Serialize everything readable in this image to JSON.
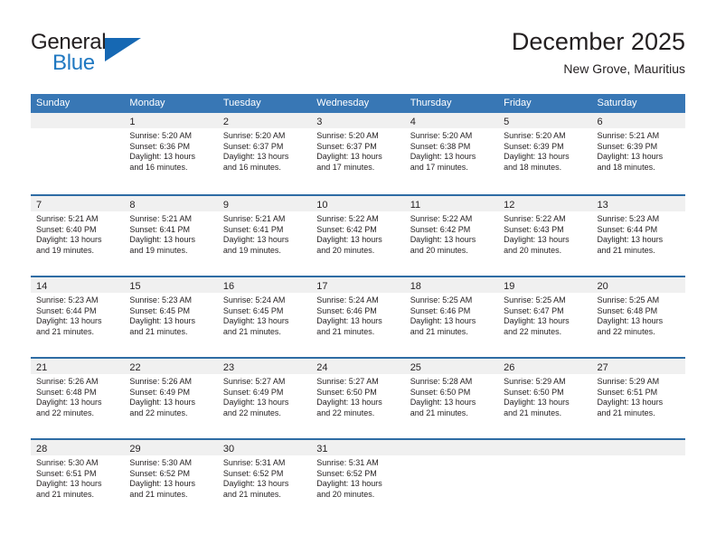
{
  "brand": {
    "name_top": "General",
    "name_bottom": "Blue",
    "accent_color": "#1668b3"
  },
  "header": {
    "title": "December 2025",
    "subtitle": "New Grove, Mauritius"
  },
  "theme": {
    "header_blue": "#3877b5",
    "row_divider_blue": "#2e6ca4",
    "day_band_gray": "#f0f0f0"
  },
  "weekdays": [
    "Sunday",
    "Monday",
    "Tuesday",
    "Wednesday",
    "Thursday",
    "Friday",
    "Saturday"
  ],
  "weeks": [
    [
      {
        "day": "",
        "sunrise": "",
        "sunset": "",
        "daylight_1": "",
        "daylight_2": ""
      },
      {
        "day": "1",
        "sunrise": "Sunrise: 5:20 AM",
        "sunset": "Sunset: 6:36 PM",
        "daylight_1": "Daylight: 13 hours",
        "daylight_2": "and 16 minutes."
      },
      {
        "day": "2",
        "sunrise": "Sunrise: 5:20 AM",
        "sunset": "Sunset: 6:37 PM",
        "daylight_1": "Daylight: 13 hours",
        "daylight_2": "and 16 minutes."
      },
      {
        "day": "3",
        "sunrise": "Sunrise: 5:20 AM",
        "sunset": "Sunset: 6:37 PM",
        "daylight_1": "Daylight: 13 hours",
        "daylight_2": "and 17 minutes."
      },
      {
        "day": "4",
        "sunrise": "Sunrise: 5:20 AM",
        "sunset": "Sunset: 6:38 PM",
        "daylight_1": "Daylight: 13 hours",
        "daylight_2": "and 17 minutes."
      },
      {
        "day": "5",
        "sunrise": "Sunrise: 5:20 AM",
        "sunset": "Sunset: 6:39 PM",
        "daylight_1": "Daylight: 13 hours",
        "daylight_2": "and 18 minutes."
      },
      {
        "day": "6",
        "sunrise": "Sunrise: 5:21 AM",
        "sunset": "Sunset: 6:39 PM",
        "daylight_1": "Daylight: 13 hours",
        "daylight_2": "and 18 minutes."
      }
    ],
    [
      {
        "day": "7",
        "sunrise": "Sunrise: 5:21 AM",
        "sunset": "Sunset: 6:40 PM",
        "daylight_1": "Daylight: 13 hours",
        "daylight_2": "and 19 minutes."
      },
      {
        "day": "8",
        "sunrise": "Sunrise: 5:21 AM",
        "sunset": "Sunset: 6:41 PM",
        "daylight_1": "Daylight: 13 hours",
        "daylight_2": "and 19 minutes."
      },
      {
        "day": "9",
        "sunrise": "Sunrise: 5:21 AM",
        "sunset": "Sunset: 6:41 PM",
        "daylight_1": "Daylight: 13 hours",
        "daylight_2": "and 19 minutes."
      },
      {
        "day": "10",
        "sunrise": "Sunrise: 5:22 AM",
        "sunset": "Sunset: 6:42 PM",
        "daylight_1": "Daylight: 13 hours",
        "daylight_2": "and 20 minutes."
      },
      {
        "day": "11",
        "sunrise": "Sunrise: 5:22 AM",
        "sunset": "Sunset: 6:42 PM",
        "daylight_1": "Daylight: 13 hours",
        "daylight_2": "and 20 minutes."
      },
      {
        "day": "12",
        "sunrise": "Sunrise: 5:22 AM",
        "sunset": "Sunset: 6:43 PM",
        "daylight_1": "Daylight: 13 hours",
        "daylight_2": "and 20 minutes."
      },
      {
        "day": "13",
        "sunrise": "Sunrise: 5:23 AM",
        "sunset": "Sunset: 6:44 PM",
        "daylight_1": "Daylight: 13 hours",
        "daylight_2": "and 21 minutes."
      }
    ],
    [
      {
        "day": "14",
        "sunrise": "Sunrise: 5:23 AM",
        "sunset": "Sunset: 6:44 PM",
        "daylight_1": "Daylight: 13 hours",
        "daylight_2": "and 21 minutes."
      },
      {
        "day": "15",
        "sunrise": "Sunrise: 5:23 AM",
        "sunset": "Sunset: 6:45 PM",
        "daylight_1": "Daylight: 13 hours",
        "daylight_2": "and 21 minutes."
      },
      {
        "day": "16",
        "sunrise": "Sunrise: 5:24 AM",
        "sunset": "Sunset: 6:45 PM",
        "daylight_1": "Daylight: 13 hours",
        "daylight_2": "and 21 minutes."
      },
      {
        "day": "17",
        "sunrise": "Sunrise: 5:24 AM",
        "sunset": "Sunset: 6:46 PM",
        "daylight_1": "Daylight: 13 hours",
        "daylight_2": "and 21 minutes."
      },
      {
        "day": "18",
        "sunrise": "Sunrise: 5:25 AM",
        "sunset": "Sunset: 6:46 PM",
        "daylight_1": "Daylight: 13 hours",
        "daylight_2": "and 21 minutes."
      },
      {
        "day": "19",
        "sunrise": "Sunrise: 5:25 AM",
        "sunset": "Sunset: 6:47 PM",
        "daylight_1": "Daylight: 13 hours",
        "daylight_2": "and 22 minutes."
      },
      {
        "day": "20",
        "sunrise": "Sunrise: 5:25 AM",
        "sunset": "Sunset: 6:48 PM",
        "daylight_1": "Daylight: 13 hours",
        "daylight_2": "and 22 minutes."
      }
    ],
    [
      {
        "day": "21",
        "sunrise": "Sunrise: 5:26 AM",
        "sunset": "Sunset: 6:48 PM",
        "daylight_1": "Daylight: 13 hours",
        "daylight_2": "and 22 minutes."
      },
      {
        "day": "22",
        "sunrise": "Sunrise: 5:26 AM",
        "sunset": "Sunset: 6:49 PM",
        "daylight_1": "Daylight: 13 hours",
        "daylight_2": "and 22 minutes."
      },
      {
        "day": "23",
        "sunrise": "Sunrise: 5:27 AM",
        "sunset": "Sunset: 6:49 PM",
        "daylight_1": "Daylight: 13 hours",
        "daylight_2": "and 22 minutes."
      },
      {
        "day": "24",
        "sunrise": "Sunrise: 5:27 AM",
        "sunset": "Sunset: 6:50 PM",
        "daylight_1": "Daylight: 13 hours",
        "daylight_2": "and 22 minutes."
      },
      {
        "day": "25",
        "sunrise": "Sunrise: 5:28 AM",
        "sunset": "Sunset: 6:50 PM",
        "daylight_1": "Daylight: 13 hours",
        "daylight_2": "and 21 minutes."
      },
      {
        "day": "26",
        "sunrise": "Sunrise: 5:29 AM",
        "sunset": "Sunset: 6:50 PM",
        "daylight_1": "Daylight: 13 hours",
        "daylight_2": "and 21 minutes."
      },
      {
        "day": "27",
        "sunrise": "Sunrise: 5:29 AM",
        "sunset": "Sunset: 6:51 PM",
        "daylight_1": "Daylight: 13 hours",
        "daylight_2": "and 21 minutes."
      }
    ],
    [
      {
        "day": "28",
        "sunrise": "Sunrise: 5:30 AM",
        "sunset": "Sunset: 6:51 PM",
        "daylight_1": "Daylight: 13 hours",
        "daylight_2": "and 21 minutes."
      },
      {
        "day": "29",
        "sunrise": "Sunrise: 5:30 AM",
        "sunset": "Sunset: 6:52 PM",
        "daylight_1": "Daylight: 13 hours",
        "daylight_2": "and 21 minutes."
      },
      {
        "day": "30",
        "sunrise": "Sunrise: 5:31 AM",
        "sunset": "Sunset: 6:52 PM",
        "daylight_1": "Daylight: 13 hours",
        "daylight_2": "and 21 minutes."
      },
      {
        "day": "31",
        "sunrise": "Sunrise: 5:31 AM",
        "sunset": "Sunset: 6:52 PM",
        "daylight_1": "Daylight: 13 hours",
        "daylight_2": "and 20 minutes."
      },
      {
        "day": "",
        "sunrise": "",
        "sunset": "",
        "daylight_1": "",
        "daylight_2": ""
      },
      {
        "day": "",
        "sunrise": "",
        "sunset": "",
        "daylight_1": "",
        "daylight_2": ""
      },
      {
        "day": "",
        "sunrise": "",
        "sunset": "",
        "daylight_1": "",
        "daylight_2": ""
      }
    ]
  ]
}
